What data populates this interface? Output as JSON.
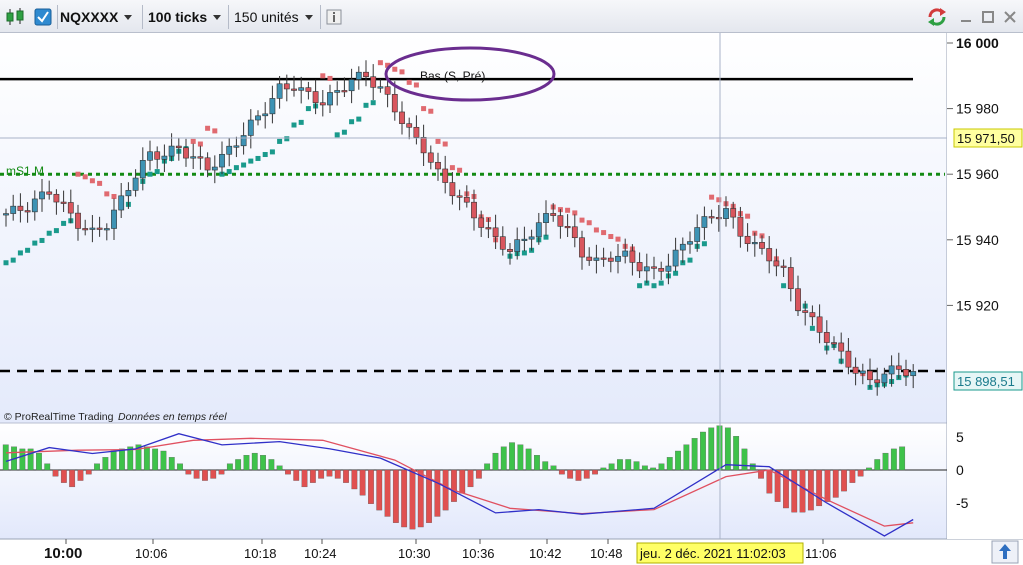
{
  "toolbar": {
    "symbol": "NQXXXX",
    "ticks": "100 ticks",
    "units": "150 unités",
    "info_icon": "info-icon",
    "chart_type_icon": "candlestick-icon",
    "check_icon": "check-icon",
    "refresh_icon": "refresh-icon",
    "minimize_icon": "minimize-icon",
    "maximize_icon": "maximize-icon",
    "close_icon": "close-icon"
  },
  "chart": {
    "annotation_text": "Bas (S, Pré)",
    "level_label": "mS1 M",
    "credit_brand": "© ProRealTime Trading",
    "credit_mode": "Données en temps réel",
    "price_labels": [
      "16 000",
      "15 980",
      "15 960",
      "15 940",
      "15 920"
    ],
    "current_price_tag": "15 971,50",
    "last_price_tag": "15 898,51",
    "osc_labels": [
      "5",
      "0",
      "-5"
    ],
    "time_labels": [
      "10:00",
      "10:06",
      "10:18",
      "10:24",
      "10:30",
      "10:36",
      "10:42",
      "10:48",
      "11:06"
    ],
    "cursor_time": "jeu. 2 déc. 2021 11:02:03",
    "scroll_icon": "scroll-up-icon"
  },
  "colors": {
    "bull": "#3e93b4",
    "bear": "#d9565e",
    "sar_bull": "#1a9a8c",
    "sar_bear": "#e06a70",
    "level_green": "#138a13",
    "annotation": "#6a2d8f",
    "histogram_up": "#3ec24a",
    "histogram_down": "#e05050",
    "macd_line": "#3030c8",
    "signal_line": "#e05060"
  },
  "chart_data": {
    "type": "candlestick",
    "price_axis": {
      "min": 15890,
      "max": 16000,
      "ticks": [
        16000,
        15980,
        15960,
        15940,
        15920
      ]
    },
    "horizontal_levels": [
      {
        "value": 15989,
        "style": "solid",
        "color": "#000000"
      },
      {
        "value": 15960,
        "style": "dotted",
        "color": "#138a13",
        "label": "mS1 M"
      },
      {
        "value": 15900,
        "style": "dashed",
        "color": "#000000"
      }
    ],
    "current_price": 15971.5,
    "last_price": 15898.51,
    "close_path": [
      [
        0,
        15948
      ],
      [
        3,
        15950
      ],
      [
        6,
        15955
      ],
      [
        8,
        15950
      ],
      [
        10,
        15945
      ],
      [
        12,
        15942
      ],
      [
        14,
        15945
      ],
      [
        16,
        15952
      ],
      [
        18,
        15960
      ],
      [
        20,
        15966
      ],
      [
        22,
        15966
      ],
      [
        24,
        15968
      ],
      [
        26,
        15965
      ],
      [
        28,
        15962
      ],
      [
        30,
        15965
      ],
      [
        32,
        15970
      ],
      [
        34,
        15975
      ],
      [
        36,
        15980
      ],
      [
        38,
        15986
      ],
      [
        40,
        15987
      ],
      [
        42,
        15984
      ],
      [
        44,
        15982
      ],
      [
        46,
        15985
      ],
      [
        48,
        15989
      ],
      [
        50,
        15990
      ],
      [
        52,
        15986
      ],
      [
        54,
        15980
      ],
      [
        56,
        15973
      ],
      [
        58,
        15968
      ],
      [
        60,
        15960
      ],
      [
        62,
        15955
      ],
      [
        64,
        15950
      ],
      [
        66,
        15945
      ],
      [
        68,
        15940
      ],
      [
        70,
        15937
      ],
      [
        72,
        15940
      ],
      [
        74,
        15945
      ],
      [
        76,
        15948
      ],
      [
        78,
        15943
      ],
      [
        80,
        15936
      ],
      [
        82,
        15933
      ],
      [
        84,
        15935
      ],
      [
        86,
        15935
      ],
      [
        88,
        15932
      ],
      [
        90,
        15930
      ],
      [
        92,
        15933
      ],
      [
        94,
        15938
      ],
      [
        96,
        15944
      ],
      [
        98,
        15947
      ],
      [
        100,
        15949
      ],
      [
        102,
        15942
      ],
      [
        104,
        15938
      ],
      [
        106,
        15935
      ],
      [
        108,
        15930
      ],
      [
        110,
        15920
      ],
      [
        112,
        15915
      ],
      [
        114,
        15910
      ],
      [
        116,
        15905
      ],
      [
        118,
        15900
      ],
      [
        120,
        15897
      ],
      [
        122,
        15899
      ],
      [
        124,
        15901
      ],
      [
        126,
        15899
      ]
    ],
    "sar": [
      [
        0,
        15933
      ],
      [
        2,
        15936
      ],
      [
        4,
        15939
      ],
      [
        6,
        15942
      ],
      [
        8,
        15945
      ],
      [
        10,
        15960
      ],
      [
        12,
        15958
      ],
      [
        14,
        15954
      ],
      [
        16,
        15950
      ],
      [
        18,
        15957
      ],
      [
        20,
        15960
      ],
      [
        22,
        15964
      ],
      [
        24,
        15967
      ],
      [
        26,
        15970
      ],
      [
        28,
        15974
      ],
      [
        30,
        15960
      ],
      [
        32,
        15962
      ],
      [
        34,
        15964
      ],
      [
        36,
        15966
      ],
      [
        38,
        15970
      ],
      [
        40,
        15975
      ],
      [
        42,
        15980
      ],
      [
        44,
        15990
      ],
      [
        46,
        15972
      ],
      [
        48,
        15976
      ],
      [
        50,
        15981
      ],
      [
        52,
        15994
      ],
      [
        54,
        15992
      ],
      [
        56,
        15988
      ],
      [
        58,
        15980
      ],
      [
        60,
        15970
      ],
      [
        62,
        15962
      ],
      [
        64,
        15954
      ],
      [
        66,
        15947
      ],
      [
        68,
        15940
      ],
      [
        70,
        15935
      ],
      [
        72,
        15936
      ],
      [
        74,
        15940
      ],
      [
        76,
        15950
      ],
      [
        78,
        15949
      ],
      [
        80,
        15946
      ],
      [
        82,
        15943
      ],
      [
        84,
        15941
      ],
      [
        86,
        15938
      ],
      [
        88,
        15926
      ],
      [
        90,
        15926
      ],
      [
        92,
        15929
      ],
      [
        94,
        15933
      ],
      [
        96,
        15938
      ],
      [
        98,
        15953
      ],
      [
        100,
        15951
      ],
      [
        102,
        15948
      ],
      [
        104,
        15942
      ],
      [
        106,
        15935
      ],
      [
        108,
        15926
      ],
      [
        110,
        15919
      ],
      [
        112,
        15913
      ],
      [
        114,
        15907
      ],
      [
        116,
        15903
      ],
      [
        118,
        15900
      ],
      [
        120,
        15895
      ],
      [
        122,
        15896
      ],
      [
        124,
        15898
      ]
    ],
    "oscillator": {
      "zero": 0,
      "ticks": [
        5,
        0,
        -5
      ],
      "macd": [
        [
          0,
          1.3
        ],
        [
          6,
          3.4
        ],
        [
          12,
          2.5
        ],
        [
          18,
          3.2
        ],
        [
          24,
          5.5
        ],
        [
          30,
          3.8
        ],
        [
          38,
          4.3
        ],
        [
          45,
          3.2
        ],
        [
          52,
          1.8
        ],
        [
          60,
          -2
        ],
        [
          68,
          -6.5
        ],
        [
          74,
          -6
        ],
        [
          80,
          -6.7
        ],
        [
          90,
          -5.8
        ],
        [
          100,
          0.8
        ],
        [
          106,
          0.5
        ],
        [
          114,
          -5
        ],
        [
          122,
          -10
        ],
        [
          126,
          -7.5
        ]
      ],
      "signal": [
        [
          0,
          2.6
        ],
        [
          10,
          3
        ],
        [
          18,
          3.1
        ],
        [
          26,
          4.5
        ],
        [
          34,
          4.8
        ],
        [
          44,
          4.5
        ],
        [
          54,
          1.5
        ],
        [
          62,
          -3
        ],
        [
          70,
          -5.8
        ],
        [
          80,
          -6.6
        ],
        [
          90,
          -6
        ],
        [
          100,
          -1
        ],
        [
          106,
          0
        ],
        [
          114,
          -4.5
        ],
        [
          122,
          -8.5
        ],
        [
          126,
          -8
        ]
      ],
      "histogram": [
        1.2,
        1.1,
        1.0,
        1.0,
        0.8,
        0.3,
        -0.3,
        -0.6,
        -0.8,
        -0.5,
        -0.2,
        0.3,
        0.6,
        0.9,
        1.0,
        1.1,
        1.2,
        1.1,
        1.0,
        0.9,
        0.6,
        0.3,
        -0.2,
        -0.4,
        -0.5,
        -0.4,
        -0.2,
        0.3,
        0.5,
        0.7,
        0.8,
        0.7,
        0.5,
        0.2,
        -0.2,
        -0.5,
        -0.8,
        -0.6,
        -0.4,
        -0.3,
        -0.4,
        -0.6,
        -0.9,
        -1.2,
        -1.6,
        -1.9,
        -2.2,
        -2.5,
        -2.7,
        -2.8,
        -2.7,
        -2.5,
        -2.2,
        -1.9,
        -1.5,
        -1.1,
        -0.8,
        -0.4,
        0.3,
        0.8,
        1.1,
        1.3,
        1.2,
        1.0,
        0.7,
        0.4,
        0.2,
        -0.2,
        -0.4,
        -0.5,
        -0.4,
        -0.2,
        0.1,
        0.3,
        0.5,
        0.5,
        0.4,
        0.2,
        0.1,
        0.3,
        0.6,
        0.9,
        1.2,
        1.5,
        1.8,
        2.0,
        2.1,
        2.0,
        1.6,
        1.0,
        0.3,
        -0.4,
        -1.1,
        -1.5,
        -1.8,
        -2.0,
        -2.0,
        -1.9,
        -1.7,
        -1.5,
        -1.3,
        -1.0,
        -0.6,
        -0.3,
        0.1,
        0.5,
        0.8,
        1.0,
        1.1
      ]
    }
  }
}
